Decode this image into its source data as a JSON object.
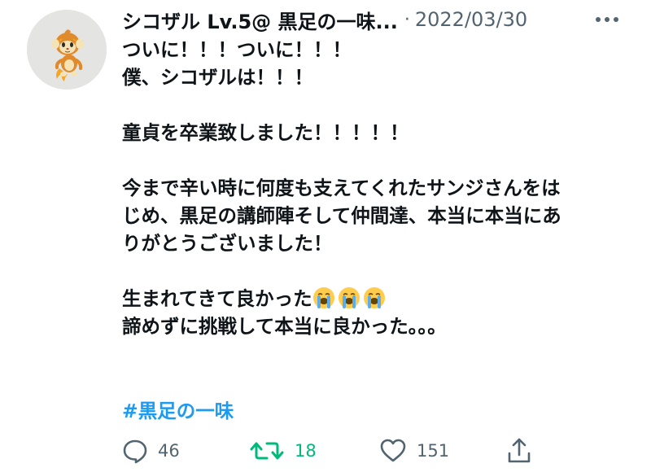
{
  "tweet": {
    "display_name": "シコザル Lv.5@ 黒足の一味...",
    "separator": "·",
    "date": "2022/03/30",
    "lines": {
      "l1": "ついに！！！ついに！！！",
      "l2": "僕、シコザルは！！！",
      "l3": "童貞を卒業致しました！！！！！",
      "l4": "今まで辛い時に何度も支えてくれたサンジさんをは",
      "l5": "じめ、黒足の講師陣そして仲間達、本当に本当にあ",
      "l6": "りがとうございました！",
      "l7": "生まれてきて良かった",
      "l8": "諦めずに挑戦して本当に良かった。。。"
    },
    "hashtag": "#黒足の一味",
    "emoji_name": "loudly-crying-face-emoji"
  },
  "actions": {
    "reply_count": "46",
    "retweet_count": "18",
    "like_count": "151"
  },
  "colors": {
    "text": "#0f1419",
    "muted": "#536471",
    "link": "#1d9bf0",
    "retweet": "#00ba7c"
  },
  "icons": {
    "more": "more-dots-icon",
    "reply": "reply-bubble-icon",
    "retweet": "retweet-icon",
    "like": "heart-icon",
    "share": "share-icon"
  }
}
